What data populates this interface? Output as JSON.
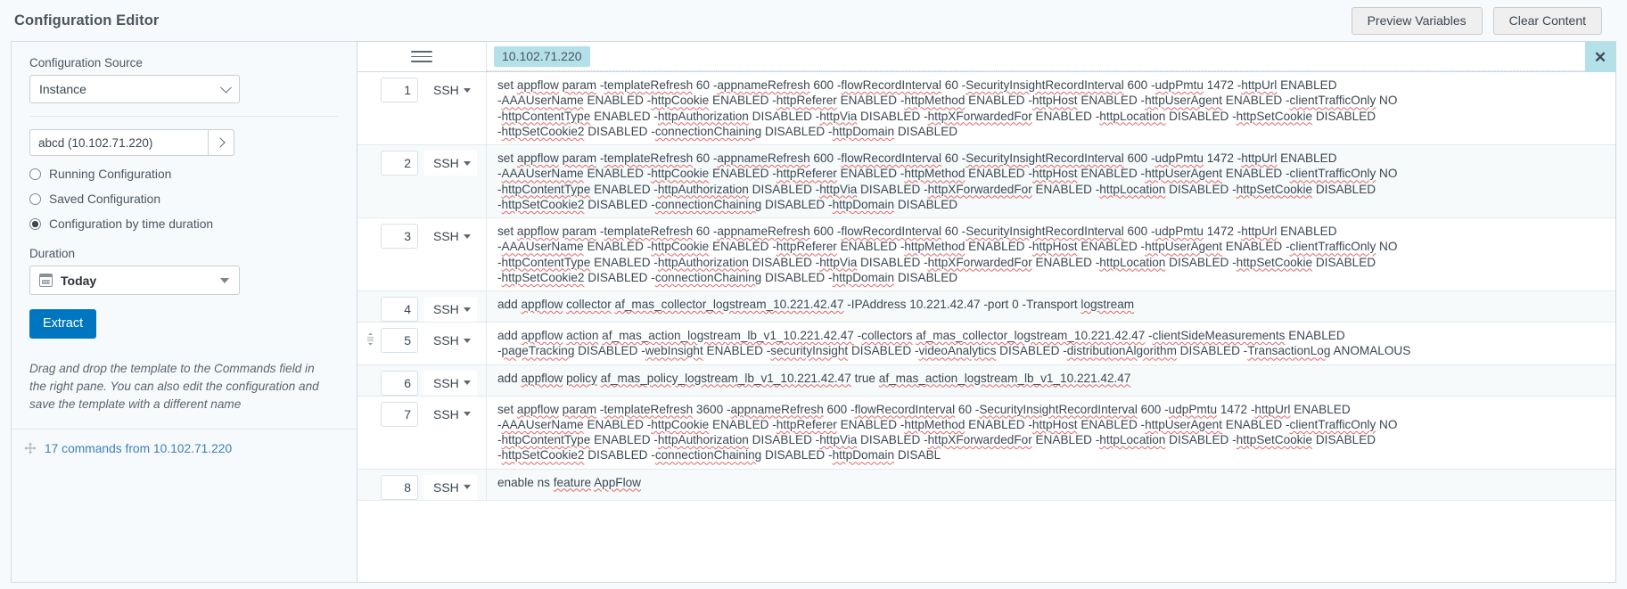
{
  "header": {
    "title": "Configuration Editor",
    "preview_variables_label": "Preview Variables",
    "clear_content_label": "Clear Content"
  },
  "sidebar": {
    "config_source_label": "Configuration Source",
    "config_source_value": "Instance",
    "instance_value": "abcd (10.102.71.220)",
    "go_icon": "chevron-right-icon",
    "radios": [
      {
        "label": "Running Configuration",
        "selected": false
      },
      {
        "label": "Saved Configuration",
        "selected": false
      },
      {
        "label": "Configuration by time duration",
        "selected": true
      }
    ],
    "duration_label": "Duration",
    "duration_value": "Today",
    "calendar_icon": "calendar-icon",
    "extract_label": "Extract",
    "hint": "Drag and drop the template to the Commands field in the right pane. You can also edit the configuration and save the template with a different name",
    "commands_link": "17 commands from 10.102.71.220",
    "move_icon": "move-handle-icon"
  },
  "editor": {
    "menu_icon": "hamburger-menu-icon",
    "tab_label": "10.102.71.220",
    "close_icon": "close-icon",
    "protocol_label": "SSH",
    "rows": [
      {
        "num": "1",
        "protocol": "SSH",
        "lines": [
          "set appflow param -templateRefresh 60 -appnameRefresh 600 -flowRecordInterval 60 -SecurityInsightRecordInterval 600 -udpPmtu 1472 -httpUrl ENABLED",
          "-AAAUserName ENABLED -httpCookie ENABLED -httpReferer ENABLED -httpMethod ENABLED -httpHost ENABLED -httpUserAgent ENABLED -clientTrafficOnly NO",
          "-httpContentType ENABLED -httpAuthorization DISABLED -httpVia DISABLED -httpXForwardedFor ENABLED -httpLocation DISABLED -httpSetCookie DISABLED",
          "-httpSetCookie2 DISABLED -connectionChaining DISABLED -httpDomain DISABLED"
        ]
      },
      {
        "num": "2",
        "protocol": "SSH",
        "lines": [
          "set appflow param -templateRefresh 60 -appnameRefresh 600 -flowRecordInterval 60 -SecurityInsightRecordInterval 600 -udpPmtu 1472 -httpUrl ENABLED",
          "-AAAUserName ENABLED -httpCookie ENABLED -httpReferer ENABLED -httpMethod ENABLED -httpHost ENABLED -httpUserAgent ENABLED -clientTrafficOnly NO",
          "-httpContentType ENABLED -httpAuthorization DISABLED -httpVia DISABLED -httpXForwardedFor ENABLED -httpLocation DISABLED -httpSetCookie DISABLED",
          "-httpSetCookie2 DISABLED -connectionChaining DISABLED -httpDomain DISABLED"
        ]
      },
      {
        "num": "3",
        "protocol": "SSH",
        "lines": [
          "set appflow param -templateRefresh 60 -appnameRefresh 600 -flowRecordInterval 60 -SecurityInsightRecordInterval 600 -udpPmtu 1472 -httpUrl ENABLED",
          "-AAAUserName ENABLED -httpCookie ENABLED -httpReferer ENABLED -httpMethod ENABLED -httpHost ENABLED -httpUserAgent ENABLED -clientTrafficOnly NO",
          "-httpContentType ENABLED -httpAuthorization DISABLED -httpVia DISABLED -httpXForwardedFor ENABLED -httpLocation DISABLED -httpSetCookie DISABLED",
          "-httpSetCookie2 DISABLED -connectionChaining DISABLED -httpDomain DISABLED"
        ]
      },
      {
        "num": "4",
        "protocol": "SSH",
        "lines": [
          "add appflow collector af_mas_collector_logstream_10.221.42.47 -IPAddress 10.221.42.47 -port 0 -Transport logstream"
        ]
      },
      {
        "num": "5",
        "protocol": "SSH",
        "has_drag_handle": true,
        "lines": [
          "add appflow action af_mas_action_logstream_lb_v1_10.221.42.47 -collectors af_mas_collector_logstream_10.221.42.47 -clientSideMeasurements ENABLED",
          "-pageTracking DISABLED -webInsight ENABLED -securityInsight DISABLED -videoAnalytics DISABLED -distributionAlgorithm DISABLED -TransactionLog ANOMALOUS"
        ]
      },
      {
        "num": "6",
        "protocol": "SSH",
        "lines": [
          "add appflow policy af_mas_policy_logstream_lb_v1_10.221.42.47 true af_mas_action_logstream_lb_v1_10.221.42.47"
        ]
      },
      {
        "num": "7",
        "protocol": "SSH",
        "lines": [
          "set appflow param -templateRefresh 3600 -appnameRefresh 600 -flowRecordInterval 60 -SecurityInsightRecordInterval 600 -udpPmtu 1472 -httpUrl ENABLED",
          "-AAAUserName ENABLED -httpCookie ENABLED -httpReferer ENABLED -httpMethod ENABLED -httpHost ENABLED -httpUserAgent ENABLED -clientTrafficOnly NO",
          "-httpContentType ENABLED -httpAuthorization DISABLED -httpVia DISABLED -httpXForwardedFor ENABLED -httpLocation DISABLED -httpSetCookie DISABLED",
          "-httpSetCookie2 DISABLED -connectionChaining DISABLED -httpDomain DISABL"
        ]
      },
      {
        "num": "8",
        "protocol": "SSH",
        "lines": [
          "enable ns feature AppFlow"
        ]
      }
    ]
  },
  "colors": {
    "accent": "#0076c0",
    "link": "#3a7ebd",
    "tab_highlight": "#b4e0ea",
    "page_bg": "#f7fafc",
    "spellcheck": "#e06666"
  }
}
